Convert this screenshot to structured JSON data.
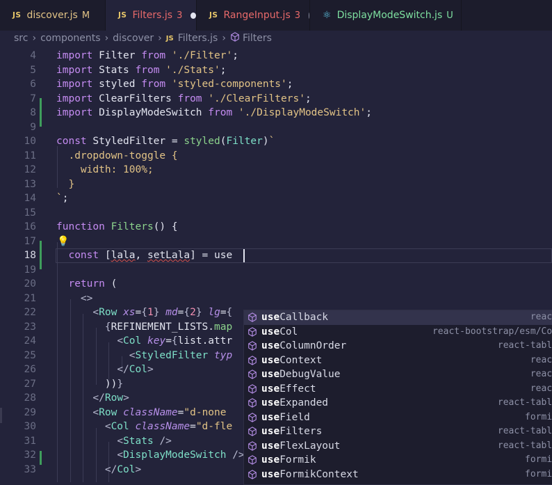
{
  "tabs": [
    {
      "label": "discover.js",
      "badge": "M",
      "active": false,
      "badge_color": "#e2c386",
      "label_color": "#e2c386"
    },
    {
      "label": "Filters.js",
      "badge": "3",
      "active": true,
      "dot": "#e3e5f0",
      "badge_color": "#e86a6a",
      "label_color": "#e86a6a"
    },
    {
      "label": "RangeInput.js",
      "badge": "3",
      "active": false,
      "dot": "#8d90a6",
      "badge_color": "#e86a6a",
      "label_color": "#e86a6a"
    },
    {
      "label": "DisplayModeSwitch.js",
      "badge": "U",
      "active": false,
      "badge_color": "#7ee0a0",
      "label_color": "#7ee0a0"
    }
  ],
  "tab_file_icon": "JS",
  "breadcrumb": {
    "parts": [
      "src",
      "components",
      "discover"
    ],
    "file": "Filters.js",
    "symbol": "Filters"
  },
  "editor": {
    "line_numbers": [
      "4",
      "5",
      "6",
      "7",
      "8",
      "9",
      "10",
      "11",
      "12",
      "13",
      "14",
      "15",
      "16",
      "17",
      "18",
      "19",
      "20",
      "21",
      "22",
      "23",
      "24",
      "25",
      "26",
      "27",
      "28",
      "29",
      "30",
      "31",
      "32",
      "33"
    ],
    "current_line": "18",
    "typed_prefix": "use",
    "colors": {
      "keyword": "#c58cf2",
      "string": "#e2c386",
      "function": "#8cd38c",
      "component": "#7ee0c8",
      "tag": "#e871a8",
      "attr": "#b68fe8"
    }
  },
  "suggestions": [
    {
      "match": "use",
      "rest": "Callback",
      "source": "react"
    },
    {
      "match": "use",
      "rest": "Col",
      "source": "react-bootstrap/esm/Col"
    },
    {
      "match": "use",
      "rest": "ColumnOrder",
      "source": "react-table"
    },
    {
      "match": "use",
      "rest": "Context",
      "source": "react"
    },
    {
      "match": "use",
      "rest": "DebugValue",
      "source": "react"
    },
    {
      "match": "use",
      "rest": "Effect",
      "source": "react"
    },
    {
      "match": "use",
      "rest": "Expanded",
      "source": "react-table"
    },
    {
      "match": "use",
      "rest": "Field",
      "source": "formik"
    },
    {
      "match": "use",
      "rest": "Filters",
      "source": "react-table"
    },
    {
      "match": "use",
      "rest": "FlexLayout",
      "source": "react-table"
    },
    {
      "match": "use",
      "rest": "Formik",
      "source": "formik"
    },
    {
      "match": "use",
      "rest": "FormikContext",
      "source": "formik"
    }
  ],
  "suggestion_icon": "cube-icon"
}
